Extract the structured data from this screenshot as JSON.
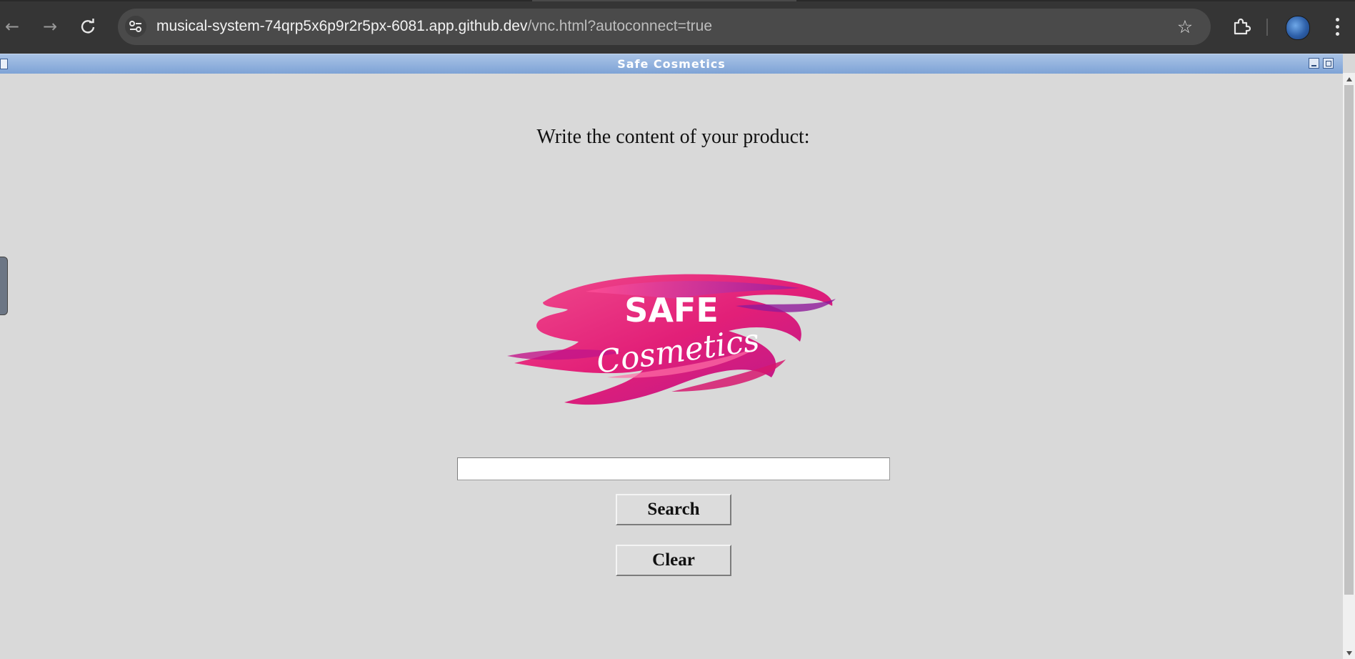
{
  "browser": {
    "url_host": "musical-system-74qrp5x6p9r2r5px-6081.app.github.dev",
    "url_path": "/vnc.html?autoconnect=true",
    "back_icon": "arrow-left-icon",
    "forward_icon": "arrow-right-icon",
    "reload_icon": "reload-icon",
    "bookmark_icon": "star-icon",
    "extensions_icon": "puzzle-icon",
    "menu_icon": "kebab-menu-icon"
  },
  "window": {
    "title": "Safe Cosmetics"
  },
  "app": {
    "prompt": "Write the content of your product:",
    "logo": {
      "line1": "SAFE",
      "line2": "Cosmetics"
    },
    "search_input": {
      "value": "",
      "placeholder": ""
    },
    "search_button": "Search",
    "clear_button": "Clear"
  },
  "colors": {
    "title_bar": "#8aaedc",
    "background": "#d9d9d9",
    "logo_pink": "#e8257d",
    "logo_magenta": "#b81c8c"
  }
}
